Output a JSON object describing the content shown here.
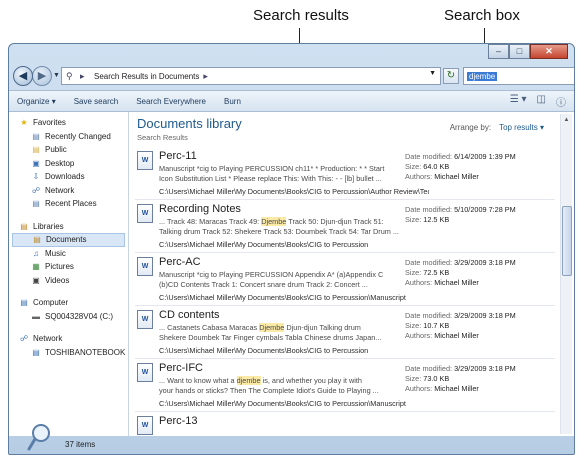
{
  "callouts": {
    "results": "Search results",
    "searchbox": "Search box"
  },
  "address": {
    "path": "Search Results in Documents",
    "search_term": "djembe"
  },
  "toolbar": {
    "organize": "Organize",
    "save_search": "Save search",
    "search_everywhere": "Search Everywhere",
    "burn": "Burn"
  },
  "sidebar": {
    "favorites": "Favorites",
    "fav_items": [
      "Recently Changed",
      "Public",
      "Desktop",
      "Downloads",
      "Network",
      "Recent Places"
    ],
    "libraries": "Libraries",
    "lib_items": [
      "Documents",
      "Music",
      "Pictures",
      "Videos"
    ],
    "computer": "Computer",
    "computer_items": [
      "SQ004328V04 (C:)"
    ],
    "network": "Network",
    "network_items": [
      "TOSHIBANOTEBOOK"
    ]
  },
  "content": {
    "title": "Documents library",
    "subtitle": "Search Results",
    "arrange_label": "Arrange by:",
    "arrange_value": "Top results"
  },
  "labels": {
    "date": "Date modified:",
    "size": "Size:",
    "authors": "Authors:"
  },
  "results": [
    {
      "title": "Perc-11",
      "s1a": "Manuscript *cig to Playing PERCUSSION ch11* * Production: * * Start",
      "s1b": "",
      "s1c": "",
      "s2a": "Icon Substitution List * Please replace This: With This: - - [lb] bullet ...",
      "s2b": "",
      "s2c": "",
      "path": "C:\\Users\\Michael Miller\\My Documents\\Books\\CIG to Percussion\\Author Review\\Tech Edit",
      "date": "6/14/2009 1:39 PM",
      "size": "64.0 KB",
      "authors": "Michael Miller"
    },
    {
      "title": "Recording Notes",
      "s1a": "... Track 48: Maracas Track 49: ",
      "s1b": "Djembe",
      "s1c": " Track 50: Djun-djun Track 51:",
      "s2a": "Talking drum Track 52: Shekere Track 53: Doumbek Track 54: Tar Drum ...",
      "s2b": "",
      "s2c": "",
      "path": "C:\\Users\\Michael Miller\\My Documents\\Books\\CIG to Percussion",
      "date": "5/10/2009 7:28 PM",
      "size": "12.5 KB",
      "authors": ""
    },
    {
      "title": "Perc-AC",
      "s1a": "Manuscript *cig to Playing PERCUSSION Appendix A* (a)Appendix C",
      "s1b": "",
      "s1c": "",
      "s2a": "(b)CD Contents Track 1: Concert snare drum Track 2: Concert ...",
      "s2b": "",
      "s2c": "",
      "path": "C:\\Users\\Michael Miller\\My Documents\\Books\\CIG to Percussion\\Manuscript",
      "date": "3/29/2009 3:18 PM",
      "size": "72.5 KB",
      "authors": "Michael Miller"
    },
    {
      "title": "CD contents",
      "s1a": "... Castanets Cabasa Maracas ",
      "s1b": "Djembe",
      "s1c": " Djun-djun Talking drum",
      "s2a": "Shekere Doumbek Tar Finger cymbals Tabla Chinese drums Japan...",
      "s2b": "",
      "s2c": "",
      "path": "C:\\Users\\Michael Miller\\My Documents\\Books\\CIG to Percussion",
      "date": "3/29/2009 3:18 PM",
      "size": "10.7 KB",
      "authors": "Michael Miller"
    },
    {
      "title": "Perc-IFC",
      "s1a": "... Want to know what a ",
      "s1b": "djembe",
      "s1c": " is, and whether you play it with",
      "s2a": "your hands or sticks? Then The Complete Idiot's Guide to Playing ...",
      "s2b": "",
      "s2c": "",
      "path": "C:\\Users\\Michael Miller\\My Documents\\Books\\CIG to Percussion\\Manuscript",
      "date": "3/29/2009 3:18 PM",
      "size": "73.0 KB",
      "authors": "Michael Miller"
    },
    {
      "title": "Perc-13",
      "s1a": "",
      "s1b": "",
      "s1c": "",
      "s2a": "",
      "s2b": "",
      "s2c": "",
      "path": "",
      "date": "",
      "size": "",
      "authors": ""
    }
  ],
  "status": {
    "count": "37 items"
  }
}
